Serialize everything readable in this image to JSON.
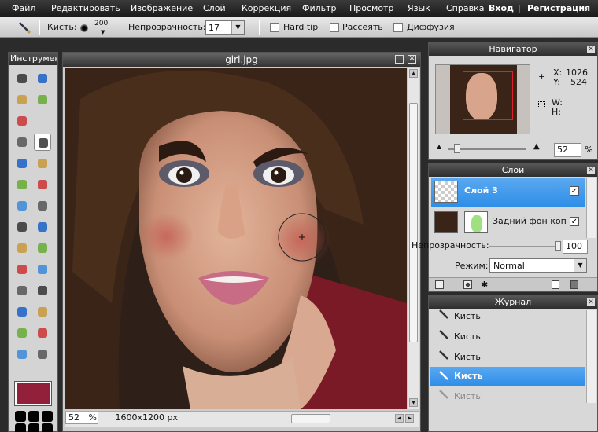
{
  "menu": [
    "Файл",
    "Редактировать",
    "Изображение",
    "Слой",
    "Коррекция",
    "Фильтр",
    "Просмотр",
    "Язык",
    "Справка"
  ],
  "auth": {
    "login": "Вход",
    "separator": "|",
    "register": "Регистрация"
  },
  "options": {
    "brush_label": "Кисть:",
    "brush_size": "200",
    "opacity_label": "Непрозрачность:",
    "opacity_value": "17",
    "hard_tip": "Hard tip",
    "scatter": "Рассеять",
    "diffusion": "Диффузия"
  },
  "tools_panel": {
    "title": "Инструменты"
  },
  "document": {
    "title": "girl.jpg",
    "zoom": "52",
    "zoom_unit": "%",
    "dimensions": "1600x1200 px"
  },
  "navigator": {
    "title": "Навигатор",
    "x_label": "X:",
    "x_value": "1026",
    "y_label": "Y:",
    "y_value": "524",
    "w_label": "W:",
    "h_label": "H:",
    "zoom": "52",
    "zoom_unit": "%"
  },
  "layers": {
    "title": "Слои",
    "items": [
      {
        "name": "Слой 3",
        "selected": true,
        "visible": true
      },
      {
        "name": "Задний фон копия",
        "selected": false,
        "visible": true
      }
    ],
    "opacity_label": "Непрозрачность:",
    "opacity_value": "100",
    "mode_label": "Режим:",
    "mode_value": "Normal"
  },
  "journal": {
    "title": "Журнал",
    "items": [
      {
        "label": "Кисть",
        "state": "normal"
      },
      {
        "label": "Кисть",
        "state": "normal"
      },
      {
        "label": "Кисть",
        "state": "normal"
      },
      {
        "label": "Кисть",
        "state": "selected"
      },
      {
        "label": "Кисть",
        "state": "undone"
      }
    ]
  },
  "colors": {
    "accent": "#2e8ee8",
    "primary_color": "#92203a"
  }
}
